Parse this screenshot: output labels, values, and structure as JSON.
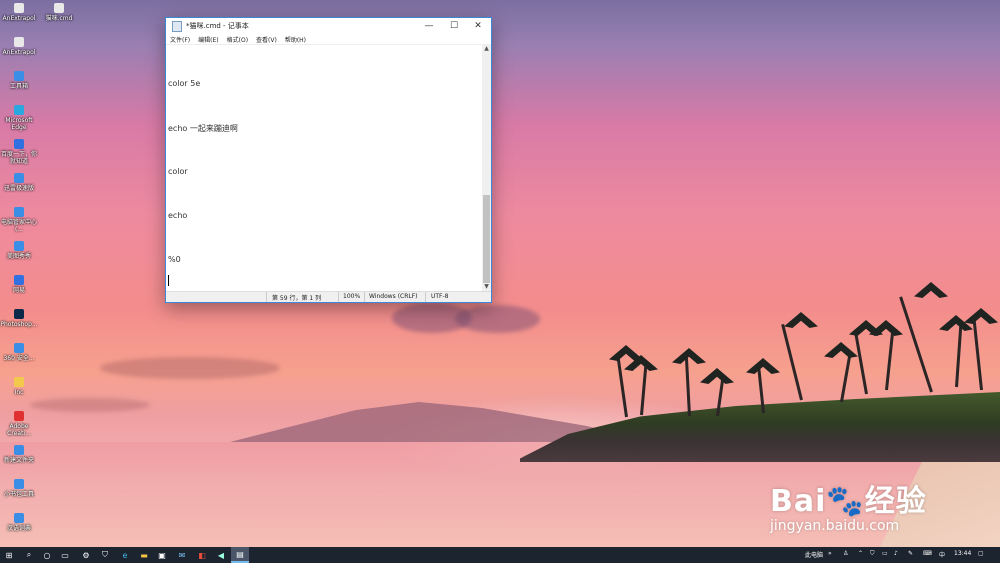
{
  "desktop": {
    "icons": [
      {
        "label": "AnExtrapol",
        "icon": "file-icon"
      },
      {
        "label": "猫咪.cmd",
        "icon": "cmd-file-icon"
      },
      {
        "label": "AnExtrapol",
        "icon": "file-icon"
      },
      {
        "label": "工具箱",
        "icon": "app-icon"
      },
      {
        "label": "Microsoft Edge",
        "icon": "edge-icon"
      },
      {
        "label": "百度一下，你就知道",
        "icon": "browser-icon"
      },
      {
        "label": "迅雷极速版",
        "icon": "app-icon"
      },
      {
        "label": "电脑管家中心 (...",
        "icon": "app-icon"
      },
      {
        "label": "美图秀秀",
        "icon": "app-icon"
      },
      {
        "label": "网易",
        "icon": "browser-icon"
      },
      {
        "label": "Photoshop...",
        "icon": "photoshop-icon"
      },
      {
        "label": "360 安全...",
        "icon": "app-icon"
      },
      {
        "label": "Inc",
        "icon": "folder-icon"
      },
      {
        "label": "Adobe Creati...",
        "icon": "adobe-icon"
      },
      {
        "label": "新建文件夹",
        "icon": "app-icon"
      },
      {
        "label": "小书包工具",
        "icon": "app-icon"
      },
      {
        "label": "汉语词典",
        "icon": "app-icon"
      }
    ]
  },
  "notepad": {
    "title": "*猫咪.cmd - 记事本",
    "minimize": "—",
    "maximize": "☐",
    "close": "✕",
    "menu": [
      "文件(F)",
      "编辑(E)",
      "格式(O)",
      "查看(V)",
      "帮助(H)"
    ],
    "lines": [
      "color 5e",
      "echo 一起来蹦迪啊",
      "color",
      "echo",
      "%0"
    ],
    "status": {
      "position": "第 59 行，第 1 列",
      "zoom": "100%",
      "line_ending": "Windows (CRLF)",
      "encoding": "UTF-8"
    }
  },
  "taskbar": {
    "tray_label": "此电脑",
    "chevron": "»",
    "time": "13:44"
  },
  "watermark": {
    "brand": "Bai",
    "brand_cn": "经验",
    "url": "jingyan.baidu.com"
  }
}
